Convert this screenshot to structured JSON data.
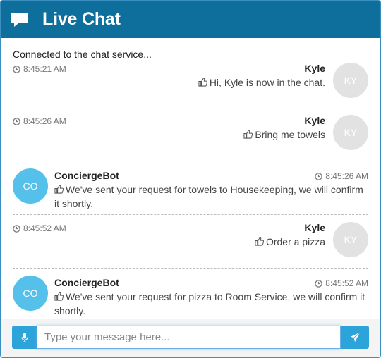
{
  "header": {
    "title": "Live Chat",
    "icon": "chat-bubble-icon"
  },
  "status": "Connected to the chat service...",
  "messages": [
    {
      "side": "right",
      "time": "8:45:21 AM",
      "sender": "Kyle",
      "text": "Hi, Kyle is now in the chat.",
      "avatar": "KY"
    },
    {
      "side": "right",
      "time": "8:45:26 AM",
      "sender": "Kyle",
      "text": "Bring me towels",
      "avatar": "KY"
    },
    {
      "side": "left",
      "time": "8:45:26 AM",
      "sender": "ConciergeBot",
      "text": "We've sent your request for towels to Housekeeping, we will confirm it shortly.",
      "avatar": "CO"
    },
    {
      "side": "right",
      "time": "8:45:52 AM",
      "sender": "Kyle",
      "text": "Order a pizza",
      "avatar": "KY"
    },
    {
      "side": "left",
      "time": "8:45:52 AM",
      "sender": "ConciergeBot",
      "text": "We've sent your request for pizza to Room Service, we will confirm it shortly.",
      "avatar": "CO"
    }
  ],
  "footer": {
    "placeholder": "Type your message here...",
    "input_value": ""
  },
  "colors": {
    "header": "#0e6f9c",
    "accent": "#2da4d9",
    "bot_avatar": "#55c0ea",
    "user_avatar": "#e2e2e2"
  }
}
